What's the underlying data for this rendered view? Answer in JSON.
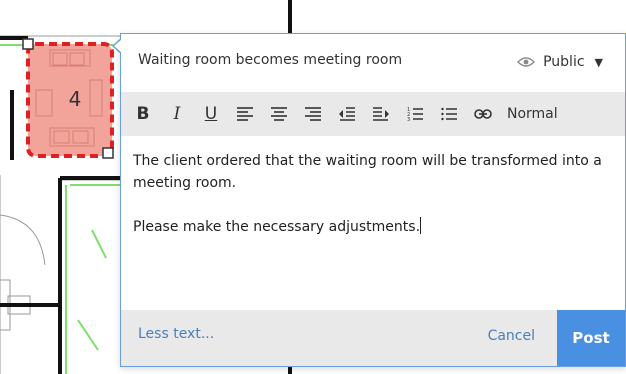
{
  "plan": {
    "room_number": "4",
    "colors": {
      "room_fill": "#f2a49a",
      "room_border": "#e02020",
      "wall": "#111111",
      "green_line": "#7ee06a",
      "thin_line": "#9a9a9a",
      "purple_line": "#b08ad0"
    }
  },
  "comment": {
    "title": "Waiting room becomes meeting room",
    "visibility": {
      "label": "Public",
      "icon": "eye-icon",
      "caret": "▼"
    },
    "toolbar": {
      "bold": "B",
      "italic": "I",
      "underline": "U",
      "format": "Normal",
      "icons": [
        "align-left-icon",
        "align-center-icon",
        "align-right-icon",
        "outdent-icon",
        "indent-icon",
        "numbered-list-icon",
        "bullet-list-icon",
        "link-icon"
      ]
    },
    "body": {
      "paragraph1": "The client ordered that the waiting room will be transformed into a meeting room.",
      "paragraph2": "Please make the necessary adjustments."
    },
    "footer": {
      "less_text": "Less text...",
      "cancel": "Cancel",
      "post": "Post"
    },
    "colors": {
      "accent": "#4a90e2",
      "link": "#4a7fb8",
      "toolbar_bg": "#e9e9e9",
      "border": "#6a9fd8"
    }
  }
}
